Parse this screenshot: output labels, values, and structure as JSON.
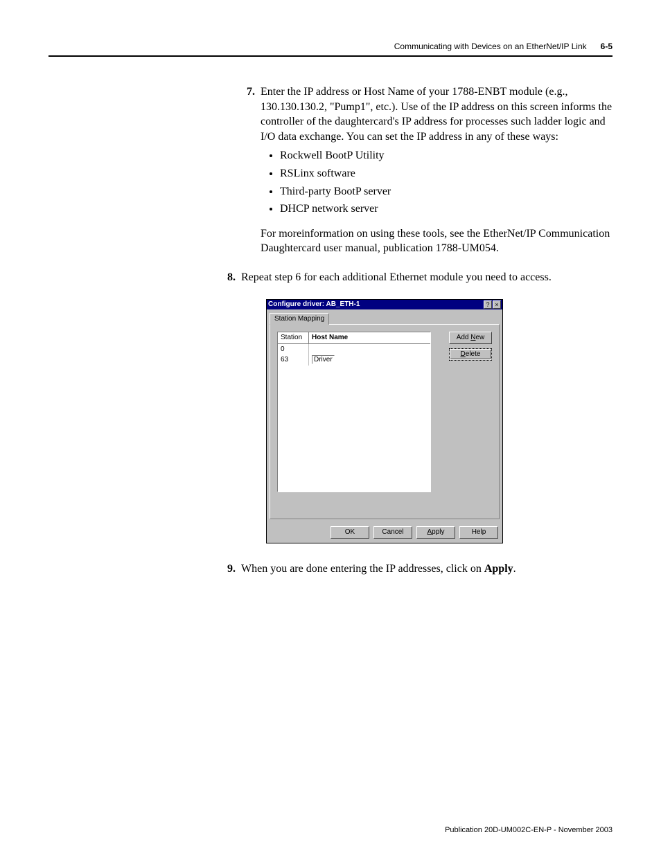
{
  "header": {
    "title": "Communicating with Devices on an EtherNet/IP Link",
    "pageno": "6-5"
  },
  "steps": {
    "s7": {
      "num": "7.",
      "text": "Enter the IP address or Host Name of your 1788-ENBT module (e.g., 130.130.130.2, \"Pump1\", etc.). Use of the IP address on this screen informs the controller of the daughtercard's IP address for processes such ladder logic and I/O data exchange. You can set the IP address in any of these ways:",
      "bullets": [
        "Rockwell BootP Utility",
        "RSLinx software",
        "Third-party BootP server",
        "DHCP network server"
      ],
      "post": "For moreinformation on using these tools, see the EtherNet/IP Communication Daughtercard user manual, publication 1788-UM054."
    },
    "s8": {
      "num": "8.",
      "text": "Repeat step 6 for each additional Ethernet module you need to access."
    },
    "s9": {
      "num": "9.",
      "textPrefix": "When you are done entering the IP addresses, click on ",
      "boldWord": "Apply",
      "textSuffix": "."
    }
  },
  "dialog": {
    "title": "Configure driver: AB_ETH-1",
    "helpGlyph": "?",
    "closeGlyph": "×",
    "tab": "Station Mapping",
    "columns": {
      "station": "Station",
      "host": "Host Name"
    },
    "rows": [
      {
        "station": "0",
        "host": ""
      },
      {
        "station": "63",
        "host": "Driver"
      }
    ],
    "buttons": {
      "addNew": {
        "pre": "Add ",
        "u": "N",
        "post": "ew"
      },
      "delete": {
        "pre": "",
        "u": "D",
        "post": "elete"
      },
      "ok": "OK",
      "cancel": "Cancel",
      "apply": {
        "pre": "",
        "u": "A",
        "post": "pply"
      },
      "help": "Help"
    }
  },
  "footer": "Publication 20D-UM002C-EN-P - November 2003"
}
